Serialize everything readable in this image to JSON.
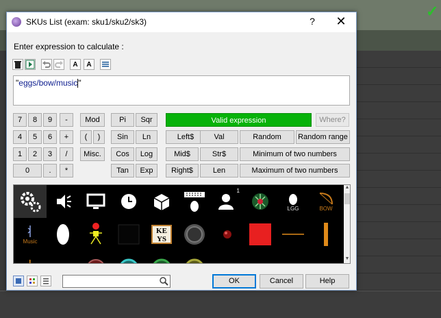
{
  "dialog": {
    "title": "SKUs List (exam: sku1/sku2/sk3)",
    "help_glyph": "?",
    "close_glyph": "✕",
    "prompt": "Enter expression to calculate :"
  },
  "toolbar": [
    "trash-icon",
    "play-icon",
    "undo-icon",
    "redo-icon",
    "font-smaller-icon",
    "font-larger-icon",
    "wrap-icon"
  ],
  "expression": {
    "open_quote": "\"",
    "value": "eggs/bow/music",
    "close_quote": "\""
  },
  "keypad": {
    "digits": [
      "7",
      "8",
      "9",
      "4",
      "5",
      "6",
      "1",
      "2",
      "3",
      "0",
      "."
    ],
    "ops": [
      "-",
      "+",
      "/",
      "*"
    ],
    "mod": "Mod",
    "paren_open": "(",
    "paren_close": ")",
    "misc": "Misc."
  },
  "math": [
    "Pi",
    "Sqr",
    "Sin",
    "Ln",
    "Cos",
    "Log",
    "Tan",
    "Exp"
  ],
  "strings": [
    "Left$",
    "Val",
    "Mid$",
    "Str$",
    "Right$",
    "Len"
  ],
  "status": {
    "valid": "Valid expression",
    "where": "Where?"
  },
  "funcs": {
    "random": "Random",
    "random_range": "Random range",
    "min": "Minimum of two numbers",
    "max": "Maximum of two numbers"
  },
  "gallery": {
    "badge": "1",
    "egg_label": "LGG",
    "bow_label": "BOW",
    "music_label": "Music",
    "keys_text": [
      "KE",
      "YS"
    ]
  },
  "footer": {
    "search_value": "",
    "ok": "OK",
    "cancel": "Cancel",
    "help": "Help"
  },
  "colors": {
    "valid_bg": "#07b20a",
    "accent": "#0078d7",
    "check": "#2bc02b"
  }
}
